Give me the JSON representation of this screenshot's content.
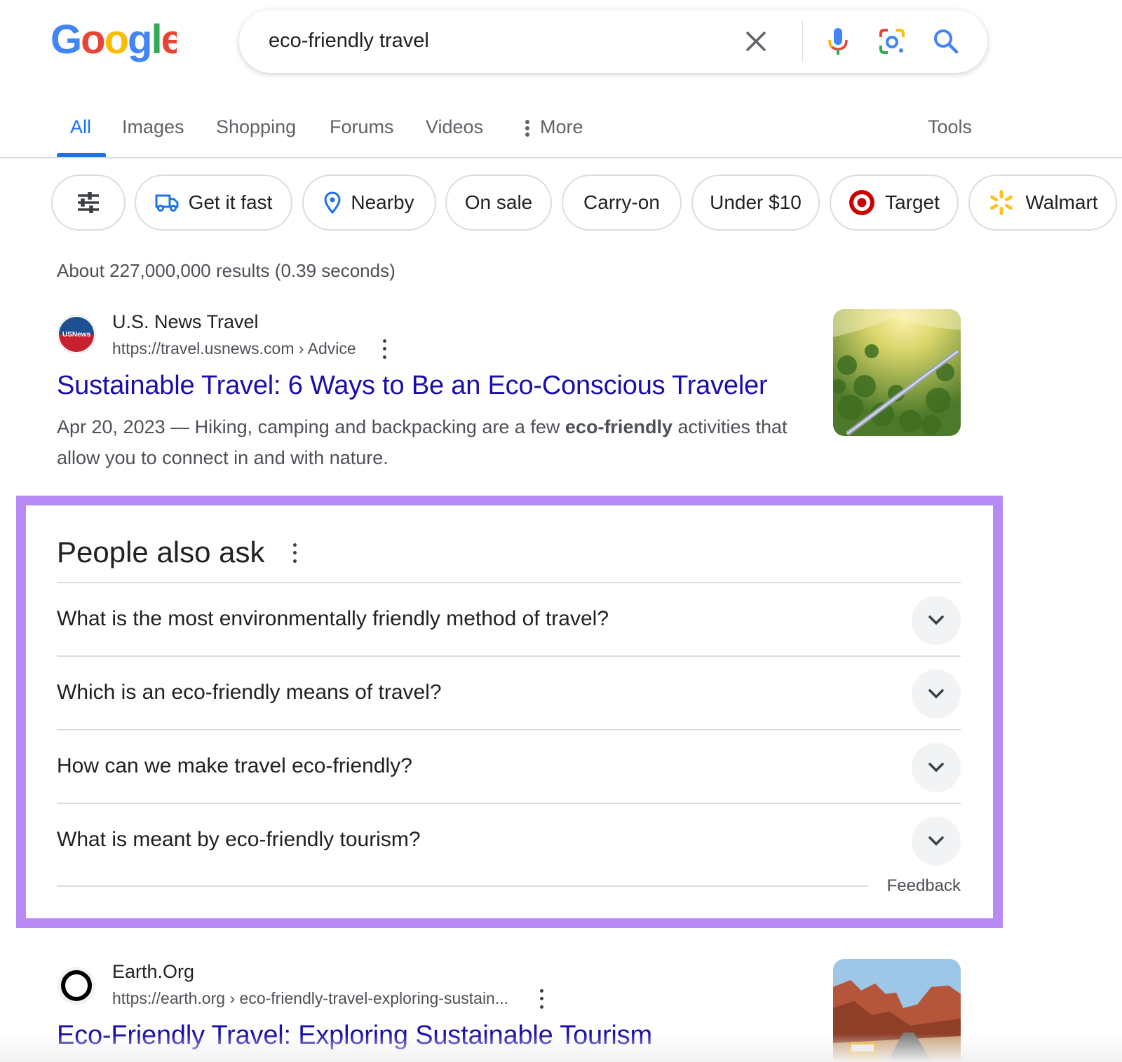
{
  "header": {
    "logo_text": "Google",
    "search_query": "eco-friendly travel",
    "icons": [
      "clear-icon",
      "microphone-icon",
      "lens-icon",
      "search-icon"
    ]
  },
  "tabs": [
    {
      "label": "All",
      "active": true
    },
    {
      "label": "Images"
    },
    {
      "label": "Shopping"
    },
    {
      "label": "Forums"
    },
    {
      "label": "Videos"
    },
    {
      "label": "More"
    },
    {
      "label": "Tools"
    }
  ],
  "chips": [
    {
      "label": "",
      "icon": "filter-sliders-icon"
    },
    {
      "label": "Get it fast",
      "icon": "truck-icon"
    },
    {
      "label": "Nearby",
      "icon": "location-pin-icon"
    },
    {
      "label": "On sale"
    },
    {
      "label": "Carry-on"
    },
    {
      "label": "Under $10"
    },
    {
      "label": "Target",
      "icon": "target-logo-icon"
    },
    {
      "label": "Walmart",
      "icon": "walmart-spark-icon"
    }
  ],
  "result_stats": "About 227,000,000 results (0.39 seconds)",
  "results": [
    {
      "site_name": "U.S. News Travel",
      "url": "https://travel.usnews.com › Advice",
      "favicon_text": "USNews",
      "title": "Sustainable Travel: 6 Ways to Be an Eco-Conscious Traveler",
      "date": "Apr 20, 2023",
      "snippet_before": " — Hiking, camping and backpacking are a few ",
      "snippet_bold": "eco-friendly",
      "snippet_after": " activities that allow you to connect in and with nature."
    },
    {
      "site_name": "Earth.Org",
      "url": "https://earth.org › eco-friendly-travel-exploring-sustain...",
      "title": "Eco-Friendly Travel: Exploring Sustainable Tourism"
    }
  ],
  "people_also_ask": {
    "title": "People also ask",
    "questions": [
      "What is the most environmentally friendly method of travel?",
      "Which is an eco-friendly means of travel?",
      "How can we make travel eco-friendly?",
      "What is meant by eco-friendly tourism?"
    ],
    "feedback_label": "Feedback"
  },
  "colors": {
    "link": "#1a0dab",
    "accent": "#1a73e8",
    "highlight_frame": "#b88af6"
  }
}
